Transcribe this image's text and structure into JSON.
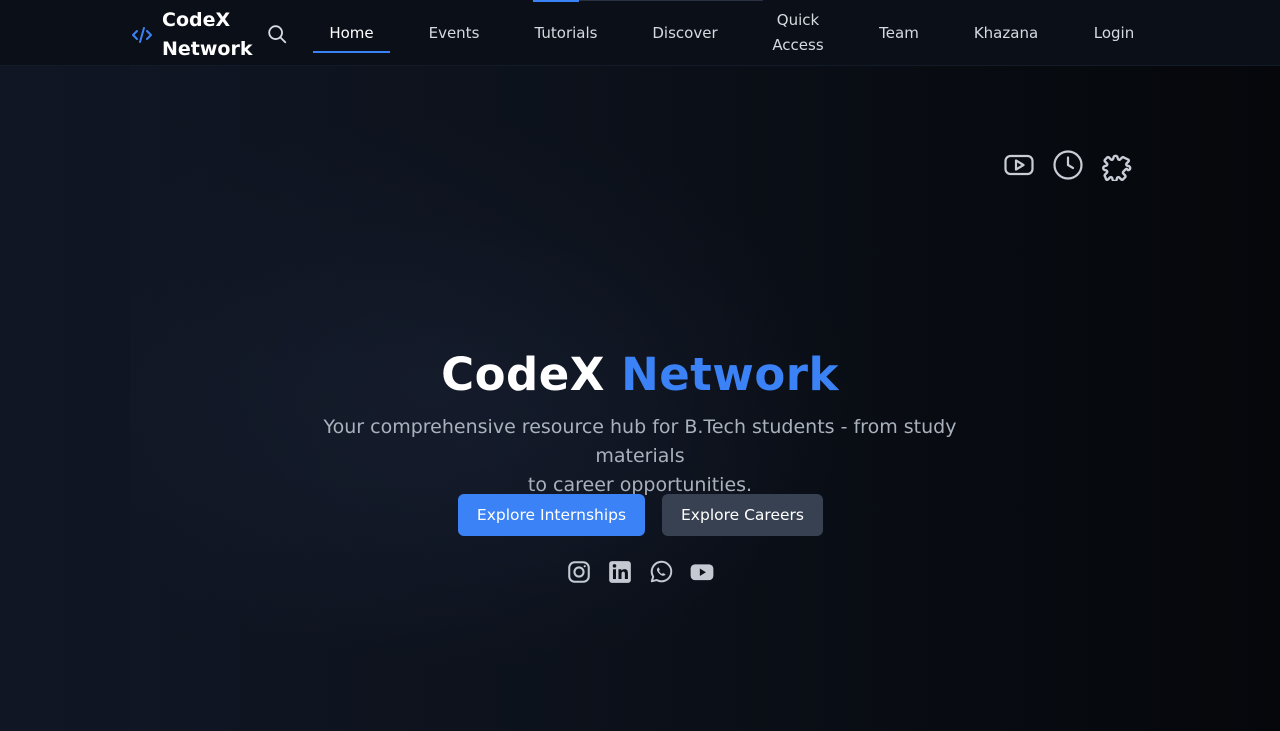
{
  "brand": {
    "line1": "CodeX",
    "line2": "Network"
  },
  "nav": {
    "items": [
      {
        "label": "Home",
        "active": true
      },
      {
        "label": "Events"
      },
      {
        "label": "Tutorials"
      },
      {
        "label": "Discover"
      },
      {
        "label": "Quick",
        "label2": "Access"
      },
      {
        "label": "Team"
      },
      {
        "label": "Khazana"
      },
      {
        "label": "Login"
      }
    ]
  },
  "floating_icons": [
    "youtube-icon",
    "clock-icon",
    "puzzle-icon"
  ],
  "hero": {
    "title_part1": "CodeX",
    "title_part2": "Network",
    "subtitle_line1": "Your comprehensive resource hub for B.Tech students - from study materials",
    "subtitle_line2": "to career opportunities.",
    "primary_button": "Explore Internships",
    "secondary_button": "Explore Careers"
  },
  "social_icons": [
    "instagram-icon",
    "linkedin-icon",
    "whatsapp-icon",
    "youtube-icon"
  ],
  "colors": {
    "accent": "#3b82f6",
    "background": "#0b0f17",
    "secondary_button": "#374151"
  }
}
